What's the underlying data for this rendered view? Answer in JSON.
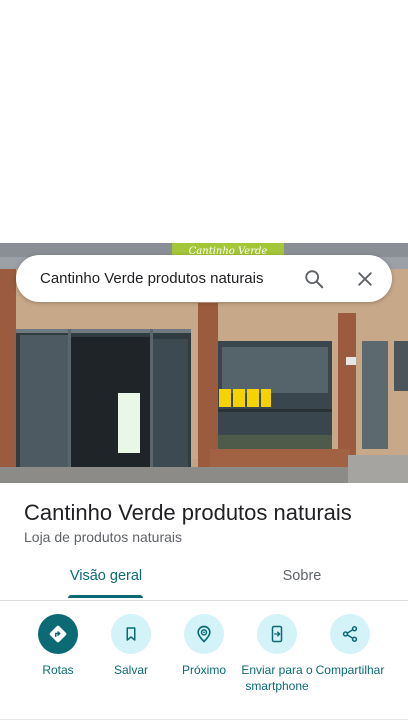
{
  "search": {
    "query": "Cantinho Verde produtos naturais",
    "search_icon": "search-icon",
    "close_icon": "close-icon"
  },
  "photo": {
    "sign_text": "Cantinho Verde"
  },
  "place": {
    "name": "Cantinho Verde produtos naturais",
    "category": "Loja de produtos naturais"
  },
  "tabs": [
    {
      "label": "Visão geral",
      "selected": true
    },
    {
      "label": "Sobre",
      "selected": false
    }
  ],
  "actions": [
    {
      "label": "Rotas",
      "icon": "directions-icon",
      "primary": true
    },
    {
      "label": "Salvar",
      "icon": "bookmark-icon",
      "primary": false
    },
    {
      "label": "Próximo",
      "icon": "nearby-icon",
      "primary": false
    },
    {
      "label": "Enviar para o smartphone",
      "icon": "send-to-phone-icon",
      "primary": false
    },
    {
      "label": "Compartilhar",
      "icon": "share-icon",
      "primary": false
    }
  ],
  "colors": {
    "accent": "#0b6a74",
    "action_bg": "#d3f3f8",
    "text_primary": "#202124",
    "text_secondary": "#5f6368"
  }
}
